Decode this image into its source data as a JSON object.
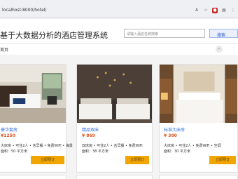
{
  "browser": {
    "url": "localhost:8000/hotel/",
    "icons": [
      "translate-icon",
      "star-icon",
      "profile-icon",
      "extension-icon",
      "menu-icon"
    ]
  },
  "header": {
    "title": "基于大数据分析的酒店管理系统",
    "search_placeholder": "请输入酒店名称搜索",
    "search_button": "搜索"
  },
  "subbar": {
    "label": "首页"
  },
  "rooms": [
    {
      "name": "豪华套房",
      "price": "¥1250",
      "desc_line1": "大床房 • 可住2人 • 含早餐 • 免费WiFi • 海景",
      "desc_line2": "面积：50 平方米",
      "book_label": "立即预订"
    },
    {
      "name": "精品双床",
      "price": "¥ 869",
      "desc_line1": "双床房 • 可住2人 • 含早餐 • 免费WiFi",
      "desc_line2": "面积：38 平方米",
      "book_label": "立即预订"
    },
    {
      "name": "标准大床房",
      "price": "¥ 380",
      "desc_line1": "大床房 • 可住2人 • 免费WiFi • 空调",
      "desc_line2": "面积：30 平方米",
      "book_label": "立即预订"
    }
  ],
  "colors": {
    "accent": "#2d6cdf",
    "price": "#e0531f",
    "button": "#f0a500"
  }
}
